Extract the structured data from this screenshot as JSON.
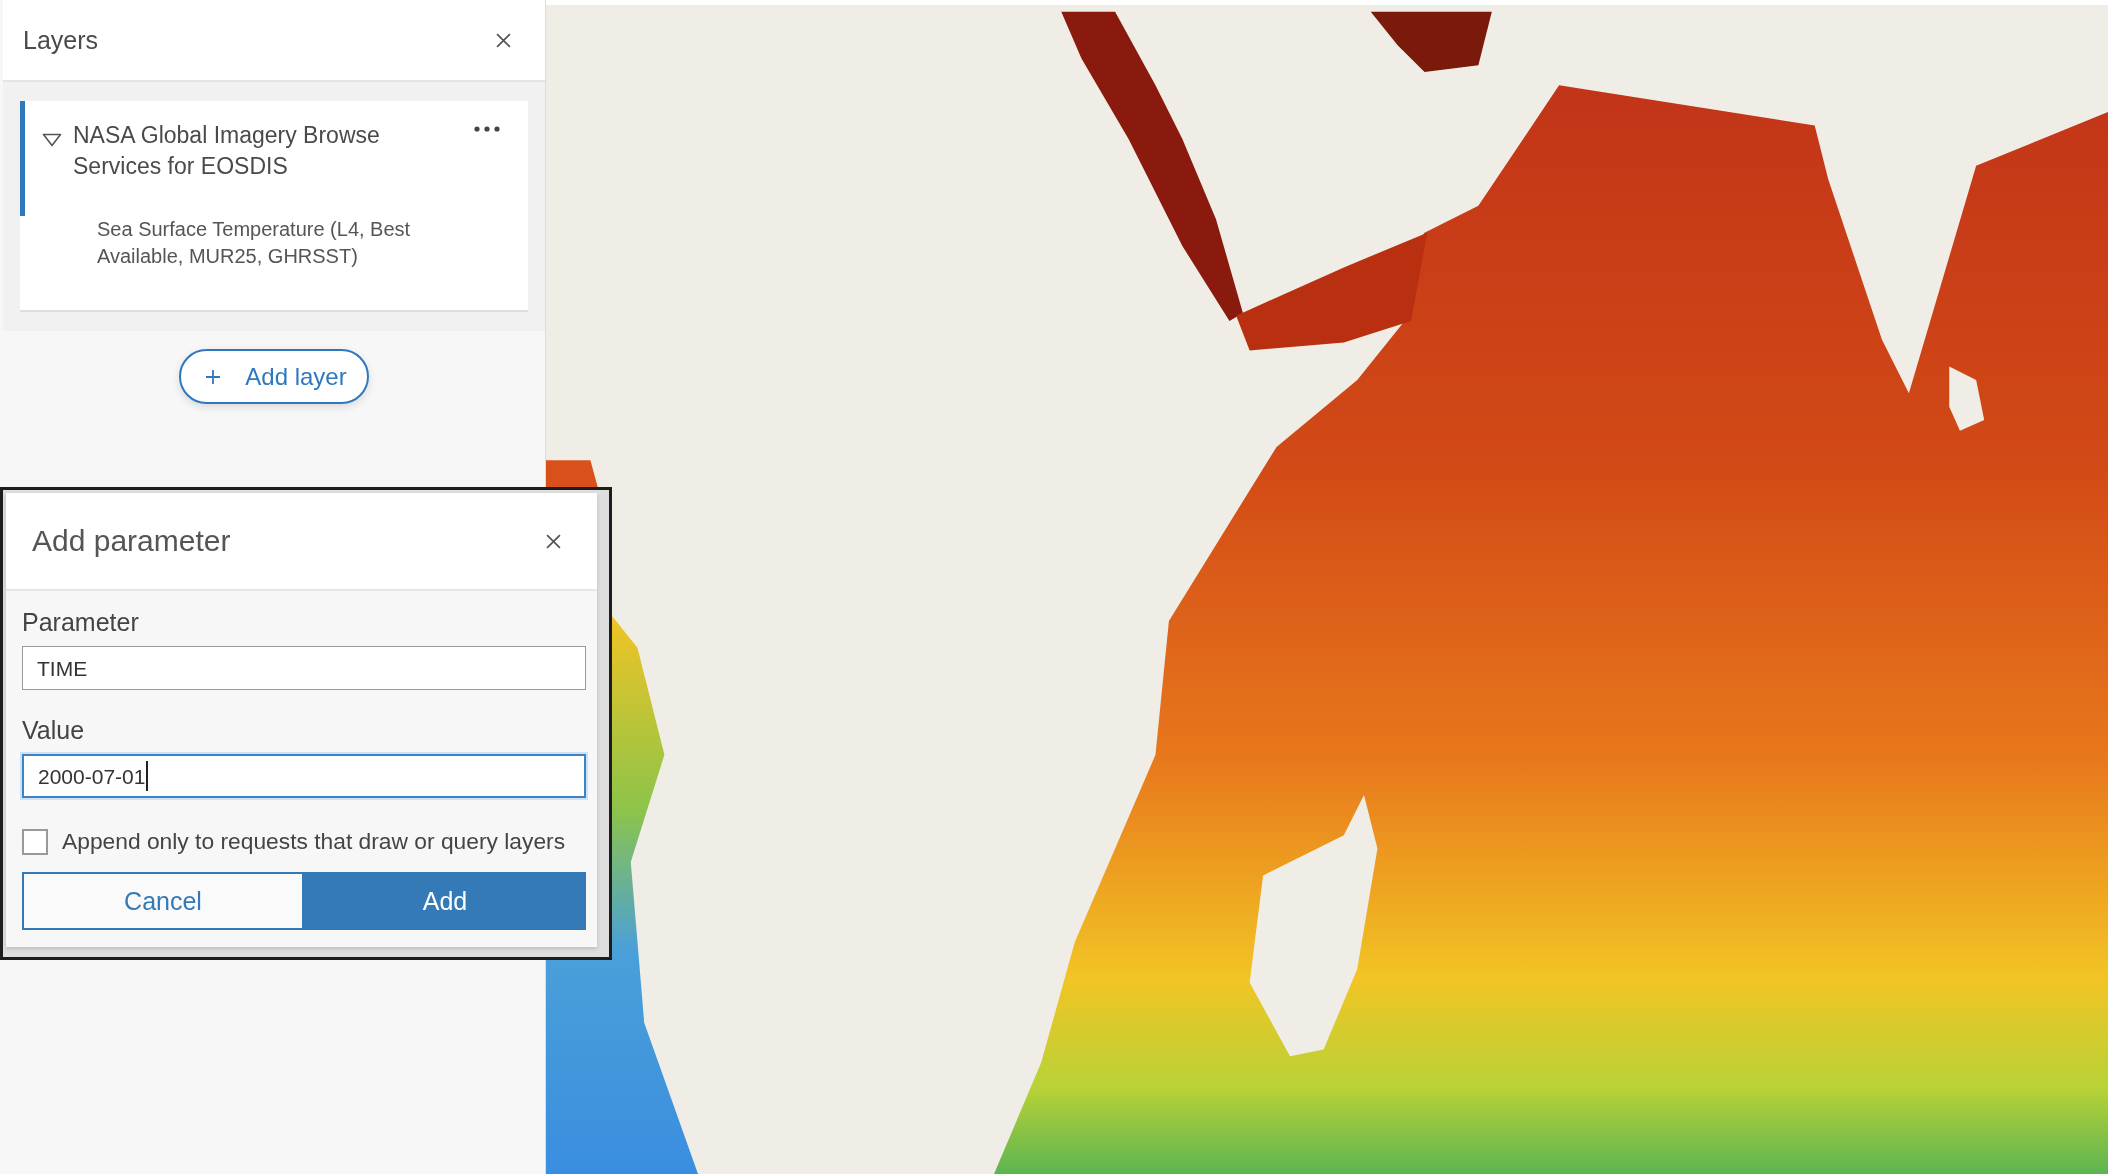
{
  "layers_panel": {
    "title": "Layers",
    "layer": {
      "title": "NASA Global Imagery Browse Services for EOSDIS",
      "expanded": true,
      "selected": true,
      "sublayers": [
        {
          "title": "Sea Surface Temperature (L4, Best Available, MUR25, GHRSST)"
        }
      ]
    },
    "add_layer_button": "Add layer"
  },
  "dialog": {
    "title": "Add parameter",
    "fields": [
      {
        "label": "Parameter",
        "value": "TIME",
        "focused": false
      },
      {
        "label": "Value",
        "value": "2000-07-01",
        "focused": true
      }
    ],
    "checkbox": {
      "label": "Append only to requests that draw or query layers",
      "checked": false
    },
    "buttons": [
      {
        "label": "Cancel",
        "kind": "secondary"
      },
      {
        "label": "Add",
        "kind": "primary"
      }
    ]
  }
}
